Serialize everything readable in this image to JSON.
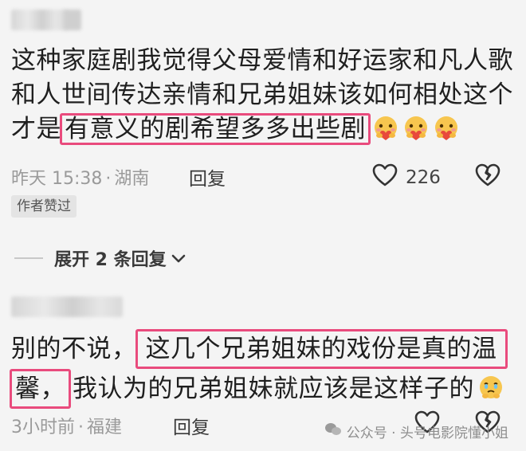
{
  "comment1": {
    "lines": [
      {
        "text": "这种家庭剧我觉得父母爱情和好运家和凡人歌"
      },
      {
        "text": "和人世间传达亲情和兄弟姐妹该如何相处这个"
      },
      {
        "pre": "才是",
        "highlight": "有意义的剧希望多多出些剧",
        "emoji": "heart-hug-emoji"
      }
    ],
    "time": "昨天 15:38",
    "separator": "·",
    "location": "湖南",
    "reply_label": "回复",
    "like_count": "226",
    "badge": "作者赞过"
  },
  "expand_label": "展开 2 条回复",
  "comment2": {
    "line1_pre": "别的不说，",
    "line1_highlight": "这几个兄弟姐妹的戏份是真的温",
    "line2_highlight": "馨，",
    "line2_post": "我认为的兄弟姐妹就应该是这样子的",
    "emoji": "crying-emoji",
    "time": "3小时前",
    "separator": "·",
    "location": "福建",
    "reply_label": "回复"
  },
  "watermark": "公众号 · 头号电影院懂小姐",
  "colors": {
    "highlight_border": "#e94b7d",
    "meta_gray": "#9a9a9a",
    "heart_red": "#e8493c"
  }
}
